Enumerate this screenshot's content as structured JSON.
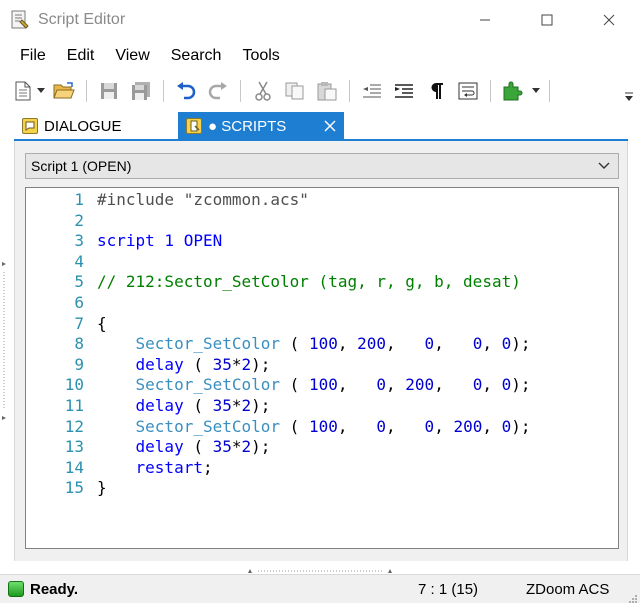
{
  "window": {
    "title": "Script Editor"
  },
  "menu": [
    "File",
    "Edit",
    "View",
    "Search",
    "Tools"
  ],
  "toolbar_icons": [
    "new-file-icon",
    "dropdown-arrow-icon",
    "open-folder-icon",
    "save-icon",
    "save-all-icon",
    "undo-icon",
    "redo-icon",
    "cut-icon",
    "copy-icon",
    "paste-icon",
    "outdent-icon",
    "indent-icon",
    "pilcrow-icon",
    "word-wrap-icon",
    "plugin-icon"
  ],
  "tabs": [
    {
      "label": "DIALOGUE",
      "active": false
    },
    {
      "label": "● SCRIPTS",
      "active": true
    }
  ],
  "script_select": {
    "value": "Script 1 (OPEN)"
  },
  "code_lines": [
    {
      "n": "1",
      "tokens": [
        {
          "t": "#include \"zcommon.acs\"",
          "c": "pp"
        }
      ]
    },
    {
      "n": "2",
      "tokens": []
    },
    {
      "n": "3",
      "tokens": [
        {
          "t": "script 1 OPEN",
          "c": "kw"
        }
      ]
    },
    {
      "n": "4",
      "tokens": []
    },
    {
      "n": "5",
      "tokens": [
        {
          "t": "// 212:Sector_SetColor (tag, r, g, b, desat)",
          "c": "cm"
        }
      ]
    },
    {
      "n": "6",
      "tokens": []
    },
    {
      "n": "7",
      "tokens": [
        {
          "t": "{",
          "c": "pl"
        }
      ]
    },
    {
      "n": "8",
      "tokens": [
        {
          "t": "    ",
          "c": "pl"
        },
        {
          "t": "Sector_SetColor",
          "c": "fn"
        },
        {
          "t": " ( ",
          "c": "pl"
        },
        {
          "t": "100",
          "c": "num"
        },
        {
          "t": ", ",
          "c": "pl"
        },
        {
          "t": "200",
          "c": "num"
        },
        {
          "t": ",   ",
          "c": "pl"
        },
        {
          "t": "0",
          "c": "num"
        },
        {
          "t": ",   ",
          "c": "pl"
        },
        {
          "t": "0",
          "c": "num"
        },
        {
          "t": ", ",
          "c": "pl"
        },
        {
          "t": "0",
          "c": "num"
        },
        {
          "t": ");",
          "c": "pl"
        }
      ]
    },
    {
      "n": "9",
      "tokens": [
        {
          "t": "    ",
          "c": "pl"
        },
        {
          "t": "delay",
          "c": "kw"
        },
        {
          "t": " ( ",
          "c": "pl"
        },
        {
          "t": "35",
          "c": "num"
        },
        {
          "t": "*",
          "c": "pl"
        },
        {
          "t": "2",
          "c": "num"
        },
        {
          "t": ");",
          "c": "pl"
        }
      ]
    },
    {
      "n": "10",
      "tokens": [
        {
          "t": "    ",
          "c": "pl"
        },
        {
          "t": "Sector_SetColor",
          "c": "fn"
        },
        {
          "t": " ( ",
          "c": "pl"
        },
        {
          "t": "100",
          "c": "num"
        },
        {
          "t": ",   ",
          "c": "pl"
        },
        {
          "t": "0",
          "c": "num"
        },
        {
          "t": ", ",
          "c": "pl"
        },
        {
          "t": "200",
          "c": "num"
        },
        {
          "t": ",   ",
          "c": "pl"
        },
        {
          "t": "0",
          "c": "num"
        },
        {
          "t": ", ",
          "c": "pl"
        },
        {
          "t": "0",
          "c": "num"
        },
        {
          "t": ");",
          "c": "pl"
        }
      ]
    },
    {
      "n": "11",
      "tokens": [
        {
          "t": "    ",
          "c": "pl"
        },
        {
          "t": "delay",
          "c": "kw"
        },
        {
          "t": " ( ",
          "c": "pl"
        },
        {
          "t": "35",
          "c": "num"
        },
        {
          "t": "*",
          "c": "pl"
        },
        {
          "t": "2",
          "c": "num"
        },
        {
          "t": ");",
          "c": "pl"
        }
      ]
    },
    {
      "n": "12",
      "tokens": [
        {
          "t": "    ",
          "c": "pl"
        },
        {
          "t": "Sector_SetColor",
          "c": "fn"
        },
        {
          "t": " ( ",
          "c": "pl"
        },
        {
          "t": "100",
          "c": "num"
        },
        {
          "t": ",   ",
          "c": "pl"
        },
        {
          "t": "0",
          "c": "num"
        },
        {
          "t": ",   ",
          "c": "pl"
        },
        {
          "t": "0",
          "c": "num"
        },
        {
          "t": ", ",
          "c": "pl"
        },
        {
          "t": "200",
          "c": "num"
        },
        {
          "t": ", ",
          "c": "pl"
        },
        {
          "t": "0",
          "c": "num"
        },
        {
          "t": ");",
          "c": "pl"
        }
      ]
    },
    {
      "n": "13",
      "tokens": [
        {
          "t": "    ",
          "c": "pl"
        },
        {
          "t": "delay",
          "c": "kw"
        },
        {
          "t": " ( ",
          "c": "pl"
        },
        {
          "t": "35",
          "c": "num"
        },
        {
          "t": "*",
          "c": "pl"
        },
        {
          "t": "2",
          "c": "num"
        },
        {
          "t": ");",
          "c": "pl"
        }
      ]
    },
    {
      "n": "14",
      "tokens": [
        {
          "t": "    ",
          "c": "pl"
        },
        {
          "t": "restart",
          "c": "kw"
        },
        {
          "t": ";",
          "c": "pl"
        }
      ]
    },
    {
      "n": "15",
      "tokens": [
        {
          "t": "}",
          "c": "pl"
        }
      ]
    }
  ],
  "status": {
    "text": "Ready.",
    "position": "7 : 1 (15)",
    "language": "ZDoom ACS"
  },
  "colors": {
    "accent": "#1e7fd2",
    "keyword": "#0000ff",
    "comment": "#008000",
    "function": "#3a8fc0",
    "number": "#0000d0",
    "line_number": "#2b91af"
  }
}
